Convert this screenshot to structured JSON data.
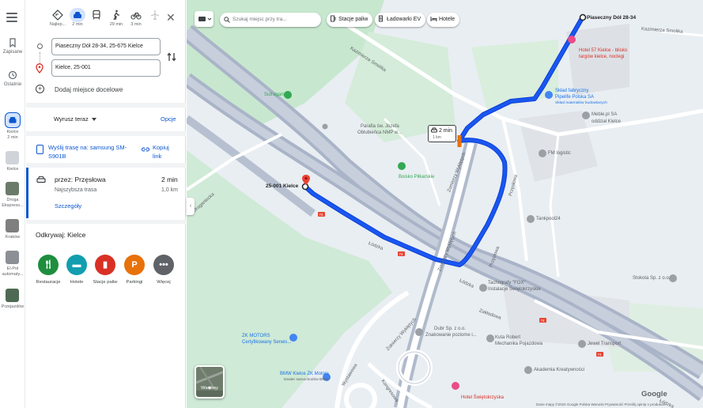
{
  "rail": {
    "saved_label": "Zapisane",
    "recent_label": "Ostatnie",
    "active_item": {
      "line1": "Kielce",
      "line2": "2 min"
    },
    "items": [
      {
        "label": "Kielce"
      },
      {
        "label": "Droga Ekspreso..."
      },
      {
        "label": "Kraków"
      },
      {
        "label": "El-Pol automaty..."
      },
      {
        "label": "Przejazdów"
      }
    ]
  },
  "modes": [
    {
      "label": "Najlep...",
      "icon": "best-route-icon"
    },
    {
      "label": "2 min",
      "icon": "car-icon",
      "active": true
    },
    {
      "label": "",
      "icon": "transit-icon"
    },
    {
      "label": "29 min",
      "icon": "walk-icon"
    },
    {
      "label": "3 min",
      "icon": "bike-icon"
    },
    {
      "label": "",
      "icon": "flight-icon"
    }
  ],
  "directions": {
    "origin": "Piaseczny Dół 28-34, 25-675 Kielce",
    "destination": "Kielce, 25-001",
    "add_destination": "Dodaj miejsce docelowe"
  },
  "depart": {
    "label": "Wyrusz teraz",
    "options_label": "Opcje"
  },
  "send": {
    "send_label": "Wyślij trasę na: samsung SM-S901B",
    "copy_label": "Kopiuj link"
  },
  "route": {
    "via": "przez: Przęsłowa",
    "time": "2 min",
    "subtitle": "Najszybsza trasa",
    "distance": "1,0 km",
    "details": "Szczegóły"
  },
  "explore": {
    "title": "Odkrywaj: Kielce",
    "categories": [
      {
        "label": "Restauracje",
        "icon": "restaurant-icon",
        "color": "#1e8e3e"
      },
      {
        "label": "Hotele",
        "icon": "hotel-icon",
        "color": "#129eaf"
      },
      {
        "label": "Stacje paliw",
        "icon": "gas-station-icon",
        "color": "#d93025"
      },
      {
        "label": "Parkingi",
        "icon": "parking-icon",
        "color": "#e8710a"
      },
      {
        "label": "Więcej",
        "icon": "more-icon",
        "color": "#5f6368"
      }
    ]
  },
  "map": {
    "search_placeholder": "Szukaj miejsc przy tra...",
    "chips": [
      {
        "label": "Stacje paliw",
        "icon": "gas-station-icon"
      },
      {
        "label": "Ładowarki EV",
        "icon": "ev-charger-icon"
      },
      {
        "label": "Hotele",
        "icon": "hotel-icon"
      }
    ],
    "layers_label": "Warstwy",
    "start_label": "Piaseczny Dół 28-34",
    "end_label": "25-001 Kielce",
    "tooltip": {
      "time": "2 min",
      "distance": "1 km"
    },
    "labels": {
      "kazimierza": "Kazimierza Smolika",
      "sufraganiec": "Sufraganiec",
      "parafia1": "Parafia św. Józefa",
      "parafia2": "Oblubieńca NMP w...",
      "boisko": "Boisko Piłkarskie",
      "hotel1": "Hotel 57 Kielce - blisko",
      "hotel2": "targów kielce, noclegi",
      "sklad1": "Skład fabryczny",
      "sklad2": "Pipelife Polska SA",
      "sklad3": "Skład materiałów budowlanych",
      "meble1": "Meble.pl SA",
      "meble2": "oddział Kielce",
      "fm": "FM logistic",
      "tankpool": "Tankpool24",
      "stokota": "Stokota Sp. z o.o.",
      "tachografy1": "Tachografy \"FOX\"",
      "tachografy2": "Instalacje Świętokrzyskie",
      "dubr1": "Dubr Sp. z o.o.",
      "dubr2": "Znakowanie poziome i...",
      "kuta1": "Kuta Robert",
      "kuta2": "Mechanika Pojazdowa",
      "jewel": "Jewel Transport",
      "akademia": "Akademia Kreatywności",
      "zk1": "ZK MOTORS",
      "zk2": "Certyfikowany Serwis...",
      "bmw1": "BMW Kielce ZK Motors",
      "bmw2": "Dealer samochodów BMW",
      "hotel_bottom": "Hotel Świętokrzyska",
      "lodzka1": "Łódzka",
      "lodzka2": "Łódzka",
      "zomierzy1": "Zomierzy Wyklętych",
      "zomierzy2": "Zomierzy Wyklętych",
      "zomierzy3": "Żołnierzy Wyklętych",
      "przeslowa": "Przęsłowa",
      "zakladowa": "Zakładowa",
      "wystawowa": "Wystawowa",
      "kongresowa": "Kongresowa",
      "sufraganiecka": "Sufraganiecka",
      "kazimierza_right": "Kazimierza Smolika",
      "piaseczna": "Piaseczna",
      "road_74": "74",
      "google": "Google",
      "footer": "Dane mapy ©2024 Google    Polska    Warunki    Prywatność    Prześlij opinię o produkcie"
    }
  },
  "colors": {
    "route": "#1a57f0",
    "accent": "#0b57d0",
    "road": "#aab4c8",
    "road_light": "#ffffff",
    "park": "#c7e8cf",
    "map_bg": "#e9eef2"
  }
}
